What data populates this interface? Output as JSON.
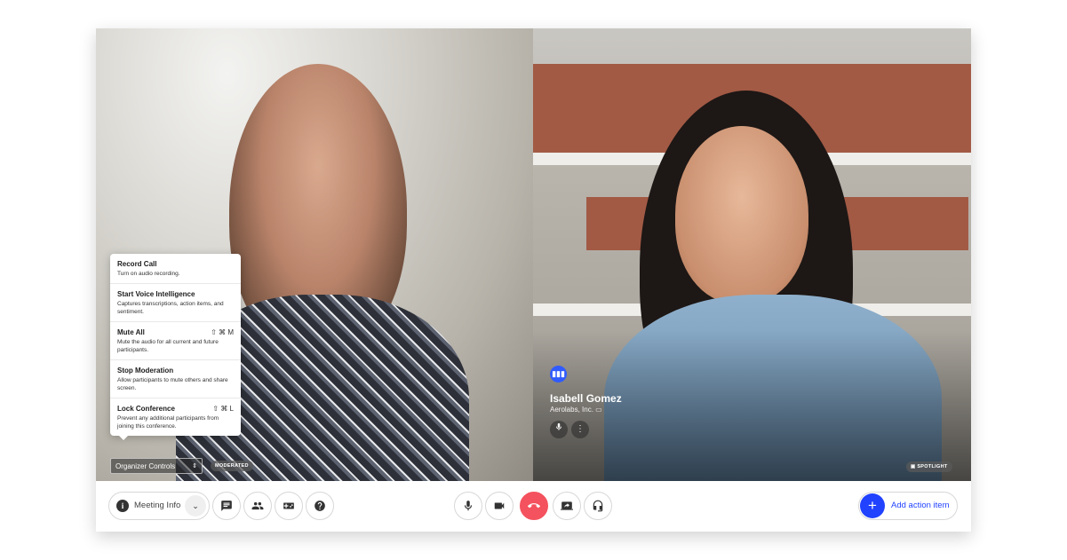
{
  "menu": {
    "items": [
      {
        "title": "Record Call",
        "desc": "Turn on audio recording.",
        "shortcut": ""
      },
      {
        "title": "Start Voice Intelligence",
        "desc": "Captures transcriptions, action items, and sentiment.",
        "shortcut": ""
      },
      {
        "title": "Mute All",
        "desc": "Mute the audio for all current and future participants.",
        "shortcut": "⇧ ⌘ M"
      },
      {
        "title": "Stop Moderation",
        "desc": "Allow participants to mute others and share screen.",
        "shortcut": ""
      },
      {
        "title": "Lock Conference",
        "desc": "Prevent any additional participants from joining this conference.",
        "shortcut": "⇧ ⌘ L"
      }
    ]
  },
  "organizer": {
    "label": "Organizer Controls",
    "arrows": "⇕"
  },
  "badges": {
    "moderated": "MODERATED",
    "spotlight": "SPOTLIGHT"
  },
  "participant": {
    "name": "Isabell Gomez",
    "org": "Aerolabs, Inc."
  },
  "toolbar": {
    "meeting_info": "Meeting Info",
    "add_action": "Add action item"
  },
  "colors": {
    "accent": "#2142ff",
    "hangup": "#f4525e",
    "speaking": "#2f5bff"
  }
}
